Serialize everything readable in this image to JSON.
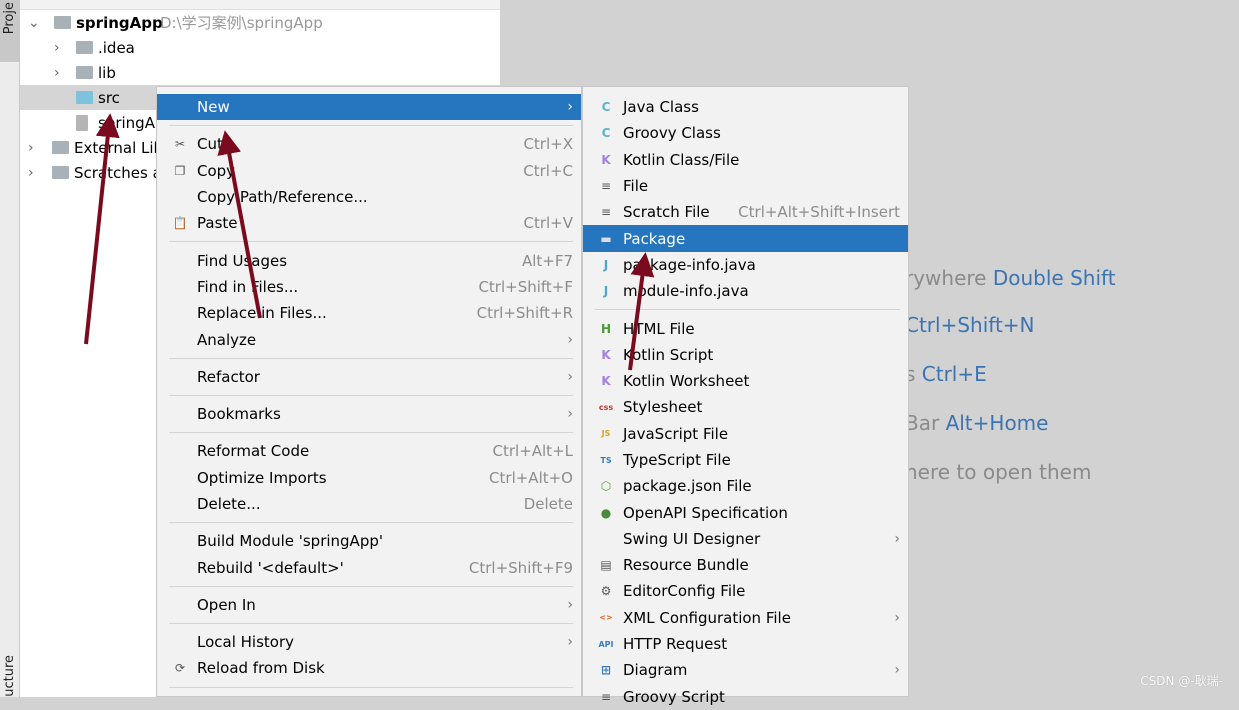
{
  "left_strip": {
    "top_tab": "Proje",
    "bottom_tab": "ucture"
  },
  "project_tree": [
    {
      "label": "springApp",
      "path": "D:\\学习案例\\springApp",
      "icon": "module-folder-icon",
      "expanded": true
    },
    {
      "label": ".idea",
      "icon": "folder-icon"
    },
    {
      "label": "lib",
      "icon": "folder-icon"
    },
    {
      "label": "src",
      "icon": "source-folder-icon",
      "selected": true
    },
    {
      "label": "springA",
      "icon": "iml-file-icon"
    },
    {
      "label": "External Lib",
      "icon": "libraries-icon"
    },
    {
      "label": "Scratches a",
      "icon": "scratches-icon"
    }
  ],
  "context_menu": [
    {
      "label": "New",
      "highlighted": true,
      "submenu": true
    },
    {
      "sep": true
    },
    {
      "label": "Cut",
      "shortcut": "Ctrl+X",
      "icon": "scissors-icon",
      "glyph": "✂"
    },
    {
      "label": "Copy",
      "shortcut": "Ctrl+C",
      "icon": "copy-icon",
      "glyph": "❐"
    },
    {
      "label": "Copy Path/Reference..."
    },
    {
      "label": "Paste",
      "shortcut": "Ctrl+V",
      "icon": "paste-icon",
      "glyph": "📋"
    },
    {
      "sep": true
    },
    {
      "label": "Find Usages",
      "shortcut": "Alt+F7"
    },
    {
      "label": "Find in Files...",
      "shortcut": "Ctrl+Shift+F"
    },
    {
      "label": "Replace in Files...",
      "shortcut": "Ctrl+Shift+R"
    },
    {
      "label": "Analyze",
      "submenu": true
    },
    {
      "sep": true
    },
    {
      "label": "Refactor",
      "submenu": true
    },
    {
      "sep": true
    },
    {
      "label": "Bookmarks",
      "submenu": true
    },
    {
      "sep": true
    },
    {
      "label": "Reformat Code",
      "shortcut": "Ctrl+Alt+L"
    },
    {
      "label": "Optimize Imports",
      "shortcut": "Ctrl+Alt+O"
    },
    {
      "label": "Delete...",
      "shortcut": "Delete"
    },
    {
      "sep": true
    },
    {
      "label": "Build Module 'springApp'"
    },
    {
      "label": "Rebuild '<default>'",
      "shortcut": "Ctrl+Shift+F9"
    },
    {
      "sep": true
    },
    {
      "label": "Open In",
      "submenu": true
    },
    {
      "sep": true
    },
    {
      "label": "Local History",
      "submenu": true
    },
    {
      "label": "Reload from Disk",
      "icon": "reload-icon",
      "glyph": "⟳"
    },
    {
      "sep": true
    }
  ],
  "new_submenu": [
    {
      "label": "Java Class",
      "icon": "java-class-icon",
      "glyph": "C",
      "color": "#5ab4d8"
    },
    {
      "label": "Groovy Class",
      "icon": "groovy-class-icon",
      "glyph": "C",
      "color": "#5ab4d8"
    },
    {
      "label": "Kotlin Class/File",
      "icon": "kotlin-file-icon",
      "glyph": "K",
      "color": "#a77de6"
    },
    {
      "label": "File",
      "icon": "file-icon",
      "glyph": "≡"
    },
    {
      "label": "Scratch File",
      "shortcut": "Ctrl+Alt+Shift+Insert",
      "icon": "scratch-file-icon",
      "glyph": "≡"
    },
    {
      "label": "Package",
      "highlighted": true,
      "icon": "package-icon",
      "glyph": "▬",
      "color": "#a9b1b8"
    },
    {
      "label": "package-info.java",
      "icon": "java-file-icon",
      "glyph": "J",
      "color": "#4aa6d6"
    },
    {
      "label": "module-info.java",
      "icon": "java-file-icon",
      "glyph": "J",
      "color": "#4aa6d6"
    },
    {
      "sep": true
    },
    {
      "label": "HTML File",
      "icon": "html-file-icon",
      "glyph": "H",
      "color": "#4a9a3a"
    },
    {
      "label": "Kotlin Script",
      "icon": "kotlin-script-icon",
      "glyph": "K",
      "color": "#a77de6"
    },
    {
      "label": "Kotlin Worksheet",
      "icon": "kotlin-worksheet-icon",
      "glyph": "K",
      "color": "#a77de6"
    },
    {
      "label": "Stylesheet",
      "icon": "css-icon",
      "glyph": "css",
      "color": "#c0392b"
    },
    {
      "label": "JavaScript File",
      "icon": "javascript-icon",
      "glyph": "JS",
      "color": "#d8a520"
    },
    {
      "label": "TypeScript File",
      "icon": "typescript-icon",
      "glyph": "TS",
      "color": "#3a7bbf"
    },
    {
      "label": "package.json File",
      "icon": "nodejs-icon",
      "glyph": "⬡",
      "color": "#5a9a3a"
    },
    {
      "label": "OpenAPI Specification",
      "icon": "openapi-icon",
      "glyph": "●",
      "color": "#4a8a3a"
    },
    {
      "label": "Swing UI Designer",
      "submenu": true
    },
    {
      "label": "Resource Bundle",
      "icon": "resource-bundle-icon",
      "glyph": "▤"
    },
    {
      "label": "EditorConfig File",
      "icon": "editorconfig-icon",
      "glyph": "⚙"
    },
    {
      "label": "XML Configuration File",
      "submenu": true,
      "icon": "xml-icon",
      "glyph": "<>",
      "color": "#d86a2a"
    },
    {
      "label": "HTTP Request",
      "icon": "http-request-icon",
      "glyph": "API",
      "color": "#3a7bbf"
    },
    {
      "label": "Diagram",
      "submenu": true,
      "icon": "diagram-icon",
      "glyph": "⊞",
      "color": "#3a7bbf"
    },
    {
      "label": "Groovy Script",
      "icon": "groovy-script-icon",
      "glyph": "≡"
    }
  ],
  "editor_hints": [
    {
      "text": "rywhere ",
      "key": "Double Shift"
    },
    {
      "text": "",
      "key": "Ctrl+Shift+N"
    },
    {
      "text": "s ",
      "key": "Ctrl+E"
    },
    {
      "text": " Bar ",
      "key": "Alt+Home"
    },
    {
      "text": "here to open them",
      "key": ""
    }
  ],
  "watermark": "CSDN @-耿瑞-",
  "colors": {
    "highlight": "#2675bf",
    "annotation_arrow": "#7a0b1e",
    "hint_key": "#3b74b3"
  }
}
